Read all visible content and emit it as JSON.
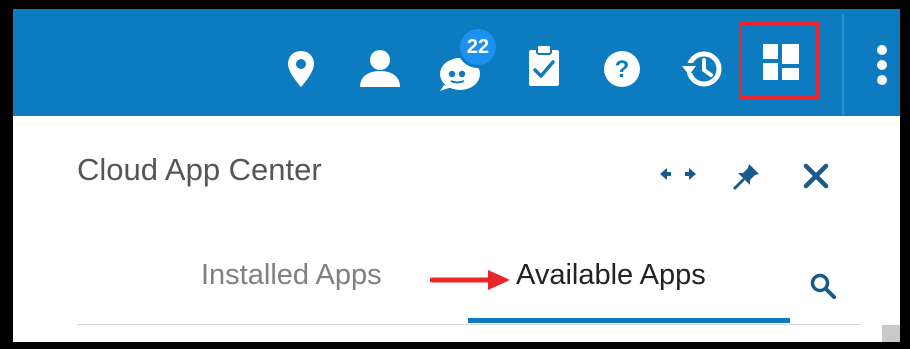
{
  "topbar": {
    "icons": [
      "location-pin-icon",
      "user-icon",
      "chat-bot-icon",
      "clipboard-check-icon",
      "help-icon",
      "history-icon",
      "app-grid-icon",
      "more-vertical-icon"
    ],
    "notification_count": "22",
    "background_color": "#0c7bbf"
  },
  "panel": {
    "title": "Cloud App Center",
    "actions": [
      "expand-horizontal-icon",
      "pin-icon",
      "close-icon"
    ]
  },
  "tabs": [
    {
      "label": "Installed Apps",
      "active": false
    },
    {
      "label": "Available Apps",
      "active": true
    }
  ],
  "search_icon": "search-icon",
  "annotation": {
    "highlight_color": "#e8262b",
    "arrow_color": "#e8262b"
  },
  "colors": {
    "accent": "#0c7bbf",
    "badge": "#1e90f0",
    "panel_icon": "#1a5a8a"
  }
}
